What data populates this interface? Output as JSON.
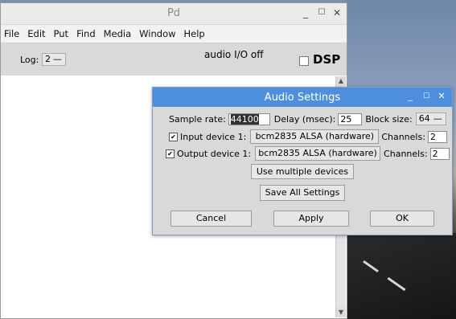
{
  "pd_window": {
    "title": "Pd",
    "controls": {
      "minimize": "_",
      "maximize": "☐",
      "close": "✕"
    },
    "menu": [
      "File",
      "Edit",
      "Put",
      "Find",
      "Media",
      "Window",
      "Help"
    ],
    "log_label": "Log:",
    "log_value": "2",
    "audio_status": "audio I/O off",
    "dsp_label": "DSP",
    "dsp_checked": false
  },
  "audio_settings": {
    "title": "Audio Settings",
    "controls": {
      "minimize": "_",
      "maximize": "☐",
      "close": "✕"
    },
    "sample_rate_label": "Sample rate:",
    "sample_rate_value": "44100",
    "delay_label": "Delay (msec):",
    "delay_value": "25",
    "block_size_label": "Block size:",
    "block_size_value": "64",
    "input_device_label": "Input device 1:",
    "input_device_checked": true,
    "input_device_value": "bcm2835 ALSA (hardware)",
    "input_channels_label": "Channels:",
    "input_channels_value": "2",
    "output_device_label": "Output device 1:",
    "output_device_checked": true,
    "output_device_value": "bcm2835 ALSA (hardware)",
    "output_channels_label": "Channels:",
    "output_channels_value": "2",
    "use_multiple_label": "Use multiple devices",
    "save_all_label": "Save All Settings",
    "cancel_label": "Cancel",
    "apply_label": "Apply",
    "ok_label": "OK"
  }
}
